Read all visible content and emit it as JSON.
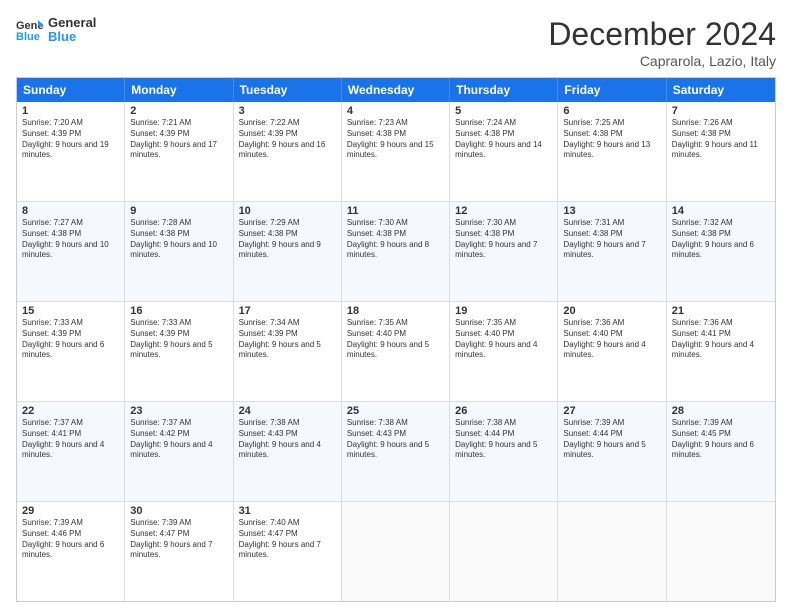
{
  "logo": {
    "line1": "General",
    "line2": "Blue"
  },
  "title": "December 2024",
  "subtitle": "Caprarola, Lazio, Italy",
  "weekdays": [
    "Sunday",
    "Monday",
    "Tuesday",
    "Wednesday",
    "Thursday",
    "Friday",
    "Saturday"
  ],
  "weeks": [
    [
      {
        "day": "1",
        "sunrise": "7:20 AM",
        "sunset": "4:39 PM",
        "daylight": "9 hours and 19 minutes."
      },
      {
        "day": "2",
        "sunrise": "7:21 AM",
        "sunset": "4:39 PM",
        "daylight": "9 hours and 17 minutes."
      },
      {
        "day": "3",
        "sunrise": "7:22 AM",
        "sunset": "4:39 PM",
        "daylight": "9 hours and 16 minutes."
      },
      {
        "day": "4",
        "sunrise": "7:23 AM",
        "sunset": "4:38 PM",
        "daylight": "9 hours and 15 minutes."
      },
      {
        "day": "5",
        "sunrise": "7:24 AM",
        "sunset": "4:38 PM",
        "daylight": "9 hours and 14 minutes."
      },
      {
        "day": "6",
        "sunrise": "7:25 AM",
        "sunset": "4:38 PM",
        "daylight": "9 hours and 13 minutes."
      },
      {
        "day": "7",
        "sunrise": "7:26 AM",
        "sunset": "4:38 PM",
        "daylight": "9 hours and 11 minutes."
      }
    ],
    [
      {
        "day": "8",
        "sunrise": "7:27 AM",
        "sunset": "4:38 PM",
        "daylight": "9 hours and 10 minutes."
      },
      {
        "day": "9",
        "sunrise": "7:28 AM",
        "sunset": "4:38 PM",
        "daylight": "9 hours and 10 minutes."
      },
      {
        "day": "10",
        "sunrise": "7:29 AM",
        "sunset": "4:38 PM",
        "daylight": "9 hours and 9 minutes."
      },
      {
        "day": "11",
        "sunrise": "7:30 AM",
        "sunset": "4:38 PM",
        "daylight": "9 hours and 8 minutes."
      },
      {
        "day": "12",
        "sunrise": "7:30 AM",
        "sunset": "4:38 PM",
        "daylight": "9 hours and 7 minutes."
      },
      {
        "day": "13",
        "sunrise": "7:31 AM",
        "sunset": "4:38 PM",
        "daylight": "9 hours and 7 minutes."
      },
      {
        "day": "14",
        "sunrise": "7:32 AM",
        "sunset": "4:38 PM",
        "daylight": "9 hours and 6 minutes."
      }
    ],
    [
      {
        "day": "15",
        "sunrise": "7:33 AM",
        "sunset": "4:39 PM",
        "daylight": "9 hours and 6 minutes."
      },
      {
        "day": "16",
        "sunrise": "7:33 AM",
        "sunset": "4:39 PM",
        "daylight": "9 hours and 5 minutes."
      },
      {
        "day": "17",
        "sunrise": "7:34 AM",
        "sunset": "4:39 PM",
        "daylight": "9 hours and 5 minutes."
      },
      {
        "day": "18",
        "sunrise": "7:35 AM",
        "sunset": "4:40 PM",
        "daylight": "9 hours and 5 minutes."
      },
      {
        "day": "19",
        "sunrise": "7:35 AM",
        "sunset": "4:40 PM",
        "daylight": "9 hours and 4 minutes."
      },
      {
        "day": "20",
        "sunrise": "7:36 AM",
        "sunset": "4:40 PM",
        "daylight": "9 hours and 4 minutes."
      },
      {
        "day": "21",
        "sunrise": "7:36 AM",
        "sunset": "4:41 PM",
        "daylight": "9 hours and 4 minutes."
      }
    ],
    [
      {
        "day": "22",
        "sunrise": "7:37 AM",
        "sunset": "4:41 PM",
        "daylight": "9 hours and 4 minutes."
      },
      {
        "day": "23",
        "sunrise": "7:37 AM",
        "sunset": "4:42 PM",
        "daylight": "9 hours and 4 minutes."
      },
      {
        "day": "24",
        "sunrise": "7:38 AM",
        "sunset": "4:43 PM",
        "daylight": "9 hours and 4 minutes."
      },
      {
        "day": "25",
        "sunrise": "7:38 AM",
        "sunset": "4:43 PM",
        "daylight": "9 hours and 5 minutes."
      },
      {
        "day": "26",
        "sunrise": "7:38 AM",
        "sunset": "4:44 PM",
        "daylight": "9 hours and 5 minutes."
      },
      {
        "day": "27",
        "sunrise": "7:39 AM",
        "sunset": "4:44 PM",
        "daylight": "9 hours and 5 minutes."
      },
      {
        "day": "28",
        "sunrise": "7:39 AM",
        "sunset": "4:45 PM",
        "daylight": "9 hours and 6 minutes."
      }
    ],
    [
      {
        "day": "29",
        "sunrise": "7:39 AM",
        "sunset": "4:46 PM",
        "daylight": "9 hours and 6 minutes."
      },
      {
        "day": "30",
        "sunrise": "7:39 AM",
        "sunset": "4:47 PM",
        "daylight": "9 hours and 7 minutes."
      },
      {
        "day": "31",
        "sunrise": "7:40 AM",
        "sunset": "4:47 PM",
        "daylight": "9 hours and 7 minutes."
      },
      null,
      null,
      null,
      null
    ]
  ]
}
